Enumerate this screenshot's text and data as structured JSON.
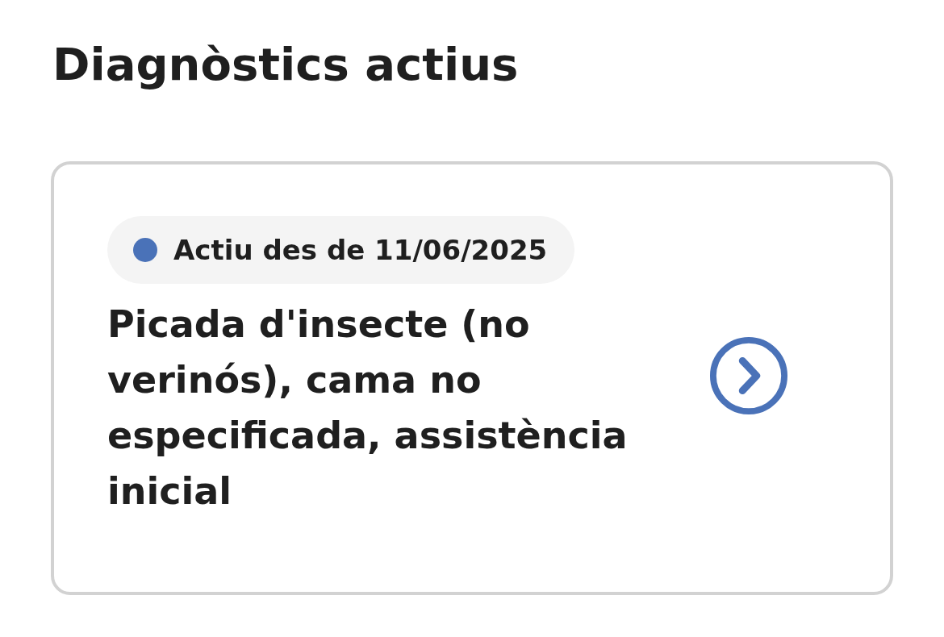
{
  "title": "Diagnòstics actius",
  "diagnoses": [
    {
      "status": {
        "label": "Actiu des de 11/06/2025",
        "color": "#4a72b8"
      },
      "name": "Picada d'insecte (no verinós), cama no especificada, assistència inicial"
    }
  ]
}
